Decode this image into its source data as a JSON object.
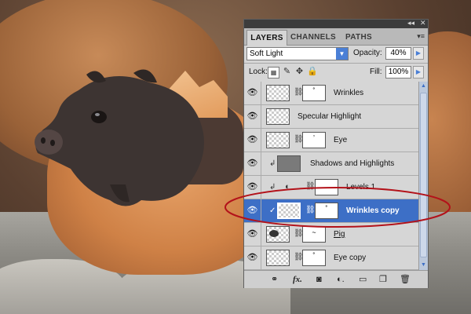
{
  "panel": {
    "tabs": [
      {
        "label": "LAYERS"
      },
      {
        "label": "CHANNELS"
      },
      {
        "label": "PATHS"
      }
    ],
    "blend_mode": "Soft Light",
    "opacity_label": "Opacity:",
    "opacity_value": "40%",
    "lock_label": "Lock:",
    "fill_label": "Fill:",
    "fill_value": "100%",
    "layers": [
      {
        "name": "Wrinkles",
        "mask": true,
        "mask_mark": "˚"
      },
      {
        "name": "Specular Highlight",
        "mask": false
      },
      {
        "name": "Eye",
        "mask": true,
        "mask_mark": "ʼ"
      },
      {
        "name": "Shadows and Highlights",
        "clipped": true
      },
      {
        "name": "Levels 1",
        "clipped": true,
        "adjustment": true
      },
      {
        "name": "Wrinkles copy",
        "selected": true,
        "mask": true,
        "mask_mark": "˚"
      },
      {
        "name": "Pig",
        "mask": true,
        "mask_mark": "~"
      },
      {
        "name": "Eye copy",
        "mask": true,
        "mask_mark": "˚"
      }
    ]
  },
  "colors": {
    "selection": "#3d6fc6",
    "callout": "#b3121a",
    "panel_bg": "#d6d6d6"
  }
}
